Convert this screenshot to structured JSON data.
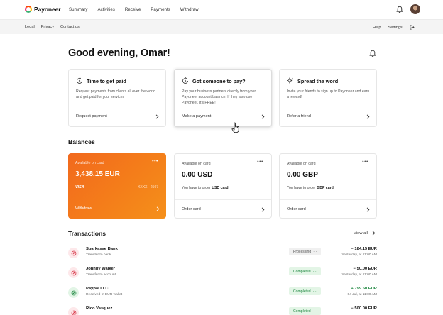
{
  "brand": {
    "name": "Payoneer"
  },
  "nav": {
    "items": [
      "Summary",
      "Activities",
      "Receive",
      "Payments",
      "Withdraw"
    ]
  },
  "subnav": {
    "left": [
      "Legal",
      "Privacy",
      "Contact us"
    ],
    "right": [
      "Help",
      "Settings"
    ]
  },
  "greeting": "Good evening, Omar!",
  "promos": [
    {
      "title": "Time to get paid",
      "text": "Request payments from clients all over the world and get paid for your services",
      "link": "Request payment",
      "icon": "dollar-refresh-icon"
    },
    {
      "title": "Got someone to pay?",
      "text": "Pay your business partners directly from your Payoneer account balance. If they also use Payoneer, it's FREE!",
      "link": "Make a payment",
      "icon": "dollar-refresh-icon"
    },
    {
      "title": "Spread the word",
      "text": "Invite your friends to sign up to Payoneer and earn a reward!",
      "link": "Refer a friend",
      "icon": "sparkle-icon"
    }
  ],
  "balances": {
    "title": "Balances",
    "cards": [
      {
        "label": "Available on card",
        "amount": "3,438.15 EUR",
        "brand": "VISA",
        "card_number": "XXXX - 2507",
        "link": "Withdraw"
      },
      {
        "label": "Available on card",
        "amount": "0.00 USD",
        "note_prefix": "You have to order",
        "note_strong": "USD card",
        "link": "Order card"
      },
      {
        "label": "Available on card",
        "amount": "0.00 GBP",
        "note_prefix": "You have to order",
        "note_strong": "GBP card",
        "link": "Order card"
      }
    ]
  },
  "transactions": {
    "title": "Transactions",
    "view_all": "View all",
    "rows": [
      {
        "name": "Sparkasse Bank",
        "desc": "Transfer to bank",
        "status": "Processing",
        "status_kind": "processing",
        "amount": "− 184.15 EUR",
        "time": "Yesterday, at 11:00 AM",
        "direction": "out"
      },
      {
        "name": "Johnny Walker",
        "desc": "Transfer to account",
        "status": "Completed",
        "status_kind": "completed",
        "amount": "− 50.00 EUR",
        "time": "Yesterday, at 11:00 AM",
        "direction": "out"
      },
      {
        "name": "Paypal LLC",
        "desc": "Received in EUR wallet",
        "status": "Completed",
        "status_kind": "completed",
        "amount": "+ 799.50 EUR",
        "time": "04 Jul, at 11:00 AM",
        "direction": "in"
      },
      {
        "name": "Rico Vasquez",
        "desc": "",
        "status": "Completed",
        "status_kind": "completed",
        "amount": "− 500.00 EUR",
        "time": "",
        "direction": "out"
      }
    ]
  },
  "colors": {
    "accent": "#f47e1a",
    "positive": "#238a44",
    "negative_bg": "#fde8ea"
  }
}
